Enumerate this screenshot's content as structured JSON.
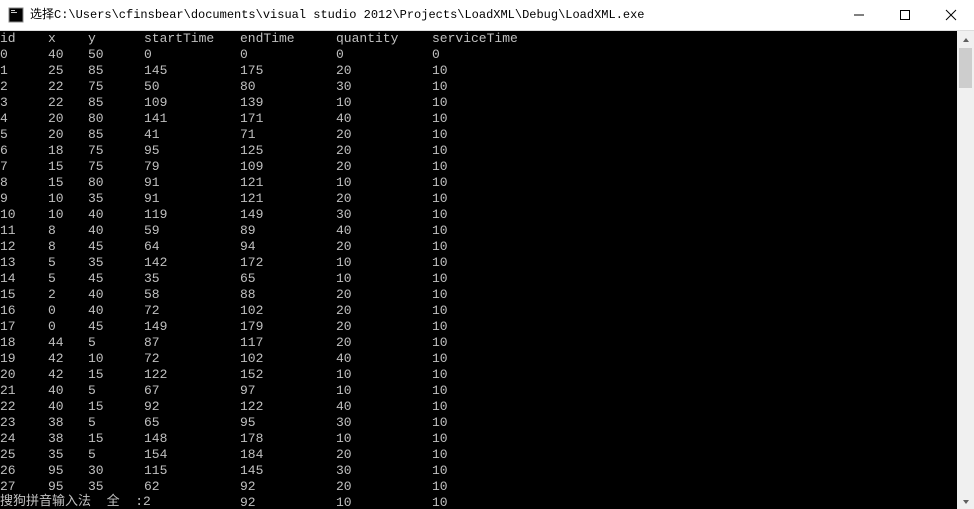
{
  "window": {
    "title": "选择C:\\Users\\cfinsbear\\documents\\visual studio 2012\\Projects\\LoadXML\\Debug\\LoadXML.exe"
  },
  "console": {
    "headers": [
      "id",
      "x",
      "y",
      "startTime",
      "endTime",
      "quantity",
      "serviceTime"
    ],
    "rows": [
      {
        "id": "0",
        "x": "40",
        "y": "50",
        "startTime": "0",
        "endTime": "0",
        "quantity": "0",
        "serviceTime": "0"
      },
      {
        "id": "1",
        "x": "25",
        "y": "85",
        "startTime": "145",
        "endTime": "175",
        "quantity": "20",
        "serviceTime": "10"
      },
      {
        "id": "2",
        "x": "22",
        "y": "75",
        "startTime": "50",
        "endTime": "80",
        "quantity": "30",
        "serviceTime": "10"
      },
      {
        "id": "3",
        "x": "22",
        "y": "85",
        "startTime": "109",
        "endTime": "139",
        "quantity": "10",
        "serviceTime": "10"
      },
      {
        "id": "4",
        "x": "20",
        "y": "80",
        "startTime": "141",
        "endTime": "171",
        "quantity": "40",
        "serviceTime": "10"
      },
      {
        "id": "5",
        "x": "20",
        "y": "85",
        "startTime": "41",
        "endTime": "71",
        "quantity": "20",
        "serviceTime": "10"
      },
      {
        "id": "6",
        "x": "18",
        "y": "75",
        "startTime": "95",
        "endTime": "125",
        "quantity": "20",
        "serviceTime": "10"
      },
      {
        "id": "7",
        "x": "15",
        "y": "75",
        "startTime": "79",
        "endTime": "109",
        "quantity": "20",
        "serviceTime": "10"
      },
      {
        "id": "8",
        "x": "15",
        "y": "80",
        "startTime": "91",
        "endTime": "121",
        "quantity": "10",
        "serviceTime": "10"
      },
      {
        "id": "9",
        "x": "10",
        "y": "35",
        "startTime": "91",
        "endTime": "121",
        "quantity": "20",
        "serviceTime": "10"
      },
      {
        "id": "10",
        "x": "10",
        "y": "40",
        "startTime": "119",
        "endTime": "149",
        "quantity": "30",
        "serviceTime": "10"
      },
      {
        "id": "11",
        "x": "8",
        "y": "40",
        "startTime": "59",
        "endTime": "89",
        "quantity": "40",
        "serviceTime": "10"
      },
      {
        "id": "12",
        "x": "8",
        "y": "45",
        "startTime": "64",
        "endTime": "94",
        "quantity": "20",
        "serviceTime": "10"
      },
      {
        "id": "13",
        "x": "5",
        "y": "35",
        "startTime": "142",
        "endTime": "172",
        "quantity": "10",
        "serviceTime": "10"
      },
      {
        "id": "14",
        "x": "5",
        "y": "45",
        "startTime": "35",
        "endTime": "65",
        "quantity": "10",
        "serviceTime": "10"
      },
      {
        "id": "15",
        "x": "2",
        "y": "40",
        "startTime": "58",
        "endTime": "88",
        "quantity": "20",
        "serviceTime": "10"
      },
      {
        "id": "16",
        "x": "0",
        "y": "40",
        "startTime": "72",
        "endTime": "102",
        "quantity": "20",
        "serviceTime": "10"
      },
      {
        "id": "17",
        "x": "0",
        "y": "45",
        "startTime": "149",
        "endTime": "179",
        "quantity": "20",
        "serviceTime": "10"
      },
      {
        "id": "18",
        "x": "44",
        "y": "5",
        "startTime": "87",
        "endTime": "117",
        "quantity": "20",
        "serviceTime": "10"
      },
      {
        "id": "19",
        "x": "42",
        "y": "10",
        "startTime": "72",
        "endTime": "102",
        "quantity": "40",
        "serviceTime": "10"
      },
      {
        "id": "20",
        "x": "42",
        "y": "15",
        "startTime": "122",
        "endTime": "152",
        "quantity": "10",
        "serviceTime": "10"
      },
      {
        "id": "21",
        "x": "40",
        "y": "5",
        "startTime": "67",
        "endTime": "97",
        "quantity": "10",
        "serviceTime": "10"
      },
      {
        "id": "22",
        "x": "40",
        "y": "15",
        "startTime": "92",
        "endTime": "122",
        "quantity": "40",
        "serviceTime": "10"
      },
      {
        "id": "23",
        "x": "38",
        "y": "5",
        "startTime": "65",
        "endTime": "95",
        "quantity": "30",
        "serviceTime": "10"
      },
      {
        "id": "24",
        "x": "38",
        "y": "15",
        "startTime": "148",
        "endTime": "178",
        "quantity": "10",
        "serviceTime": "10"
      },
      {
        "id": "25",
        "x": "35",
        "y": "5",
        "startTime": "154",
        "endTime": "184",
        "quantity": "20",
        "serviceTime": "10"
      },
      {
        "id": "26",
        "x": "95",
        "y": "30",
        "startTime": "115",
        "endTime": "145",
        "quantity": "30",
        "serviceTime": "10"
      },
      {
        "id": "27",
        "x": "95",
        "y": "35",
        "startTime": "62",
        "endTime": "92",
        "quantity": "20",
        "serviceTime": "10"
      }
    ],
    "partial_row": {
      "x": "",
      "y": "",
      "startTime": "",
      "endTime": "92",
      "quantity": "10",
      "serviceTime": "10"
    }
  },
  "ime": {
    "text": "搜狗拼音输入法  全  :2"
  }
}
